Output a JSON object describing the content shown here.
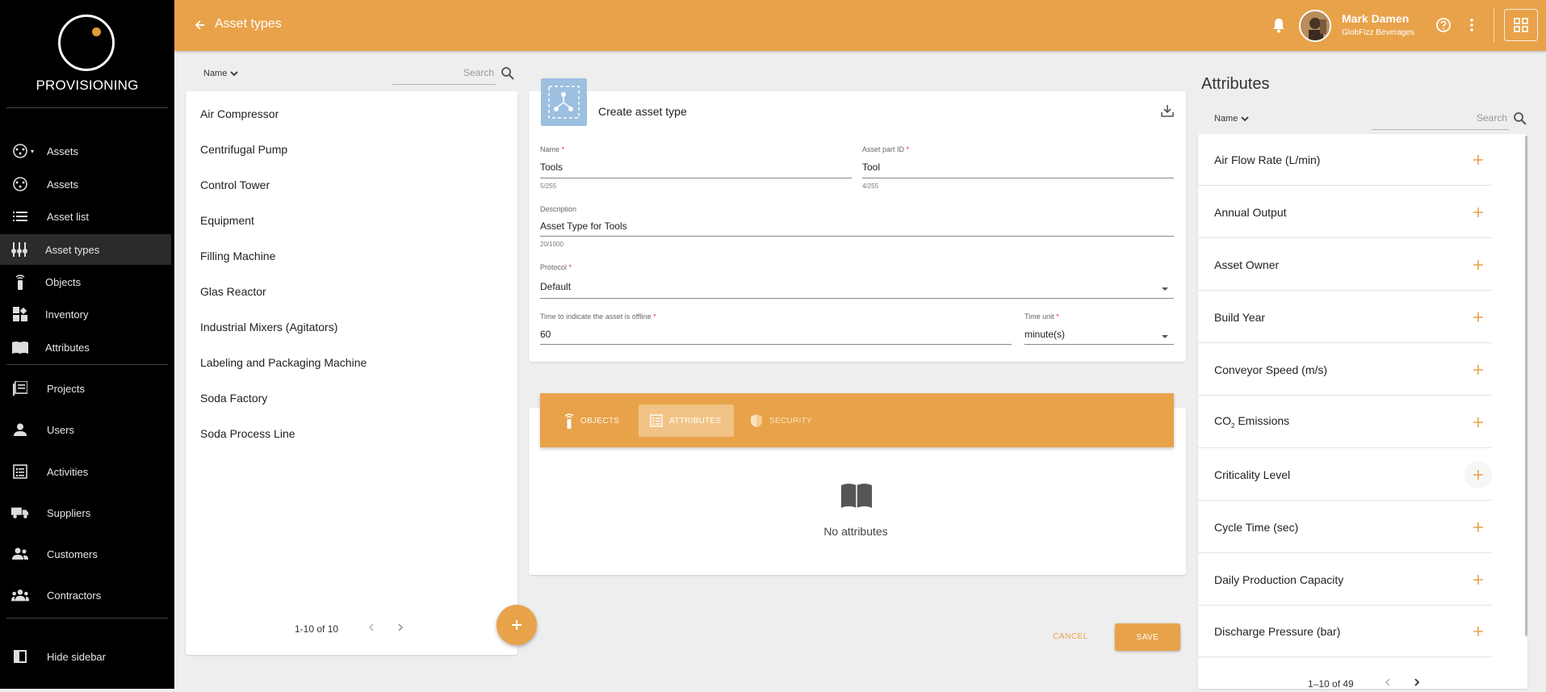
{
  "sidebar": {
    "brand": "PROVISIONING",
    "items": [
      {
        "label": "Assets",
        "icon": "asset-group-icon"
      },
      {
        "label": "Assets",
        "icon": "asset-icon"
      },
      {
        "label": "Asset list",
        "icon": "list-icon"
      },
      {
        "label": "Asset types",
        "icon": "asset-types-icon"
      },
      {
        "label": "Objects",
        "icon": "sensor-icon"
      },
      {
        "label": "Inventory",
        "icon": "inventory-icon"
      },
      {
        "label": "Attributes",
        "icon": "book-icon"
      },
      {
        "label": "Projects",
        "icon": "projects-icon"
      },
      {
        "label": "Users",
        "icon": "user-icon"
      },
      {
        "label": "Activities",
        "icon": "activities-icon"
      },
      {
        "label": "Suppliers",
        "icon": "truck-icon"
      },
      {
        "label": "Customers",
        "icon": "customers-icon"
      },
      {
        "label": "Contractors",
        "icon": "contractors-icon"
      }
    ],
    "hide_label": "Hide sidebar"
  },
  "topbar": {
    "title": "Asset types",
    "user_name": "Mark Damen",
    "user_org": "GlobFizz Beverages",
    "accent": "#e8a24a"
  },
  "left_list": {
    "sort_label": "Name",
    "search_placeholder": "Search",
    "items": [
      "Air Compressor",
      "Centrifugal Pump",
      "Control Tower",
      "Equipment",
      "Filling Machine",
      "Glas Reactor",
      "Industrial Mixers (Agitators)",
      "Labeling and Packaging Machine",
      "Soda Factory",
      "Soda Process Line"
    ],
    "pagination": "1-10 of 10"
  },
  "form": {
    "title": "Create asset type",
    "name_label": "Name",
    "name_value": "Tools",
    "name_counter": "5/255",
    "part_label": "Asset part ID",
    "part_value": "Tool",
    "part_counter": "4/255",
    "desc_label": "Description",
    "desc_value": "Asset Type for Tools",
    "desc_counter": "20/1000",
    "protocol_label": "Protocol",
    "protocol_value": "Default",
    "offline_label": "Time to indicate the asset is offline",
    "offline_value": "60",
    "unit_label": "Time unit",
    "unit_value": "minute(s)",
    "required_mark": "*"
  },
  "tabs": [
    {
      "label": "OBJECTS",
      "icon": "sensor-icon"
    },
    {
      "label": "ATTRIBUTES",
      "icon": "attributes-list-icon"
    },
    {
      "label": "SECURITY",
      "icon": "shield-icon"
    }
  ],
  "empty_state": "No attributes",
  "actions": {
    "cancel": "CANCEL",
    "save": "SAVE"
  },
  "attributes": {
    "title": "Attributes",
    "sort_label": "Name",
    "search_placeholder": "Search",
    "items": [
      "Air Flow Rate (L/min)",
      "Annual Output",
      "Asset Owner",
      "Build Year",
      "Conveyor Speed (m/s)",
      "CO",
      "Criticality Level",
      "Cycle Time (sec)",
      "Daily Production Capacity",
      "Discharge Pressure (bar)"
    ],
    "co2_sub": "2",
    "co2_rest": " Emissions",
    "pagination": "1–10 of 49"
  }
}
